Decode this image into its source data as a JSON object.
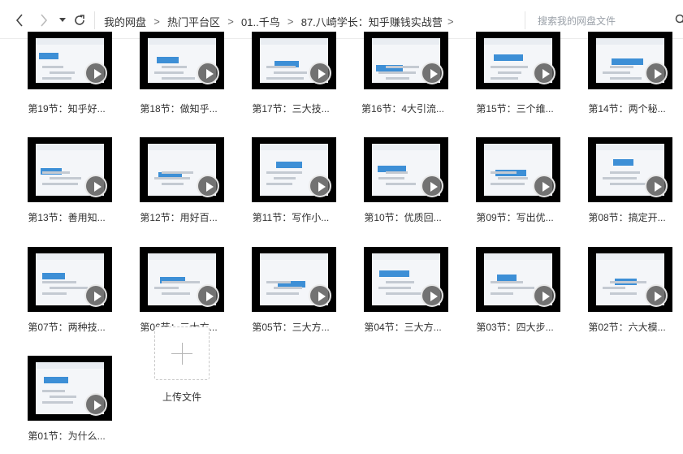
{
  "toolbar": {
    "back_icon": "chevron-left-icon",
    "forward_icon": "chevron-right-icon",
    "history_dropdown_icon": "caret-down-icon",
    "refresh_icon": "refresh-icon",
    "breadcrumb": [
      "我的网盘",
      "热门平台区",
      "01..千鸟",
      "87.八崎学长：知乎赚钱实战营"
    ],
    "breadcrumb_separator": ">",
    "search_placeholder": "搜索我的网盘文件",
    "search_icon": "search-icon"
  },
  "files": [
    {
      "name": "第19节：知乎好..."
    },
    {
      "name": "第18节：做知乎..."
    },
    {
      "name": "第17节：三大技..."
    },
    {
      "name": "第16节：4大引流..."
    },
    {
      "name": "第15节：三个维..."
    },
    {
      "name": "第14节：两个秘..."
    },
    {
      "name": "第13节：善用知..."
    },
    {
      "name": "第12节：用好百..."
    },
    {
      "name": "第11节：写作小..."
    },
    {
      "name": "第10节：优质回..."
    },
    {
      "name": "第09节：写出优..."
    },
    {
      "name": "第08节：搞定开..."
    },
    {
      "name": "第07节：两种技..."
    },
    {
      "name": "第06节：三大方..."
    },
    {
      "name": "第05节：三大方..."
    },
    {
      "name": "第04节：三大方..."
    },
    {
      "name": "第03节：四大步..."
    },
    {
      "name": "第02节：六大模..."
    },
    {
      "name": "第01节：为什么..."
    }
  ],
  "upload": {
    "label": "上传文件",
    "icon": "plus-icon"
  },
  "colors": {
    "accent": "#3d8fd6",
    "thumb_bg": "#000000",
    "play_overlay": "#5a5a5a"
  }
}
